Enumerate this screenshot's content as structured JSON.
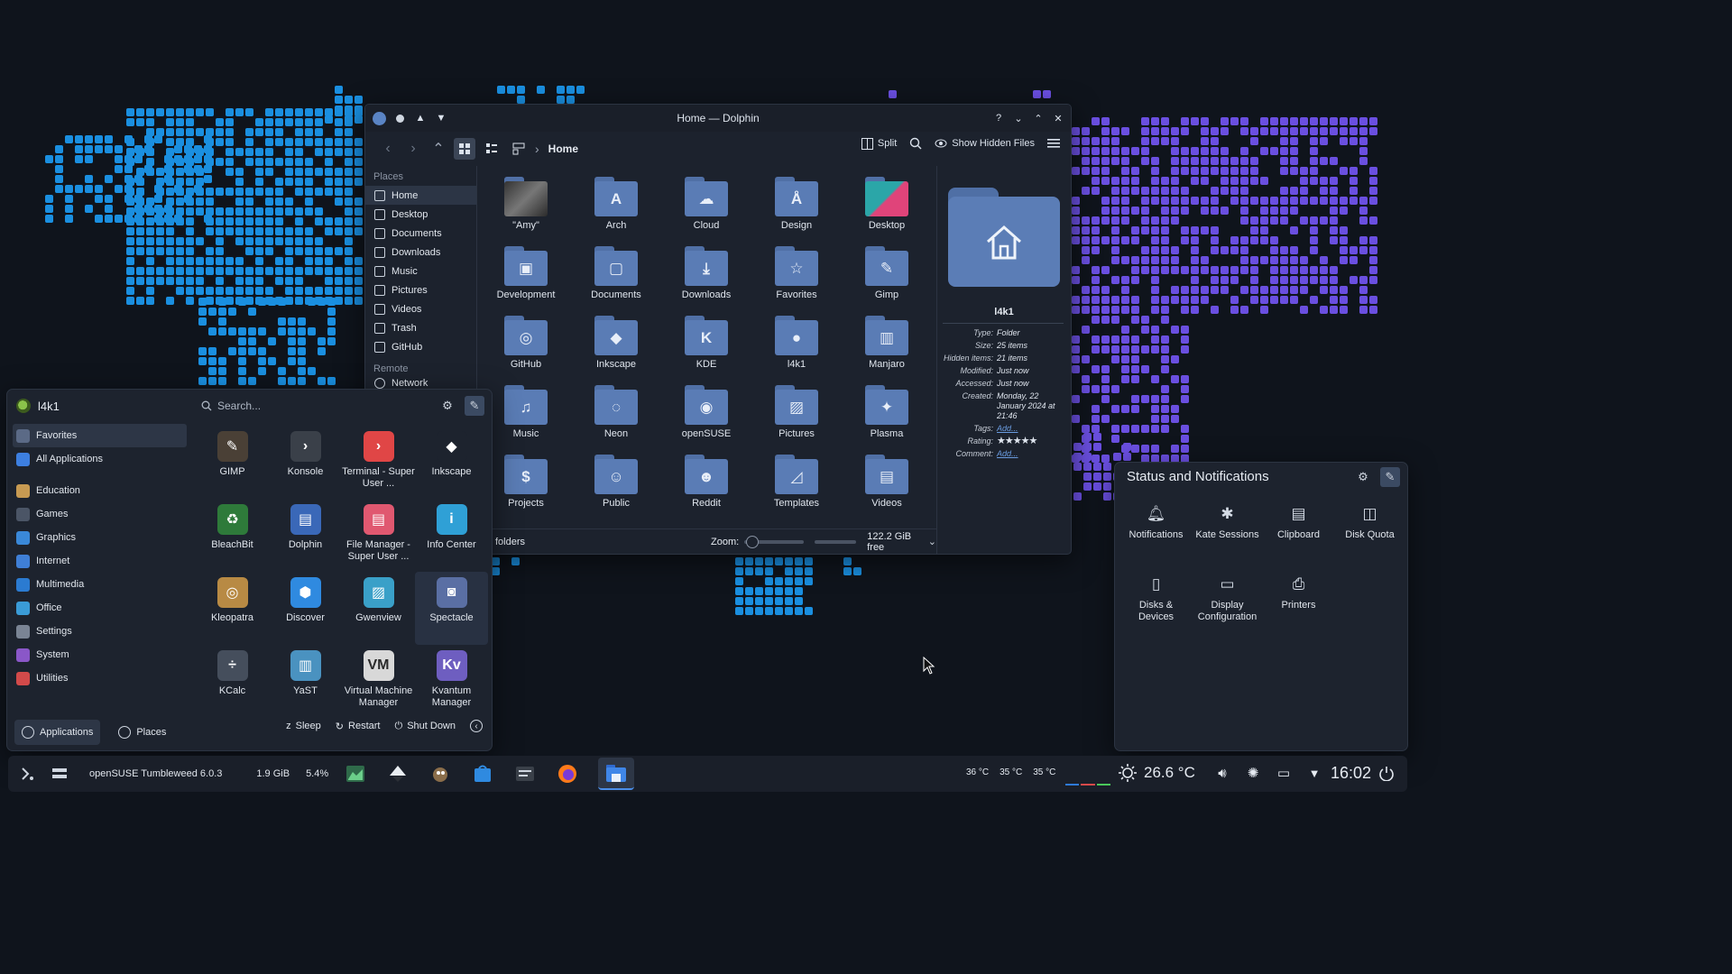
{
  "dolphin": {
    "title": "Home — Dolphin",
    "breadcrumb": "Home",
    "split_label": "Split",
    "hidden_files_label": "Show Hidden Files",
    "places_header": "Places",
    "remote_header": "Remote",
    "places": [
      {
        "label": "Home",
        "icon": "home-icon",
        "active": true
      },
      {
        "label": "Desktop",
        "icon": "desktop-icon"
      },
      {
        "label": "Documents",
        "icon": "documents-icon"
      },
      {
        "label": "Downloads",
        "icon": "downloads-icon"
      },
      {
        "label": "Music",
        "icon": "music-icon"
      },
      {
        "label": "Pictures",
        "icon": "pictures-icon"
      },
      {
        "label": "Videos",
        "icon": "videos-icon"
      },
      {
        "label": "Trash",
        "icon": "trash-icon"
      },
      {
        "label": "GitHub",
        "icon": "github-icon"
      }
    ],
    "remote_item": "Network",
    "files": [
      {
        "name": "\"Amy\"",
        "glyph": "",
        "style": "img"
      },
      {
        "name": "Arch",
        "glyph": "A"
      },
      {
        "name": "Cloud",
        "glyph": "☁"
      },
      {
        "name": "Design",
        "glyph": "Å"
      },
      {
        "name": "Desktop",
        "glyph": "",
        "style": "desk"
      },
      {
        "name": "Development",
        "glyph": "▣"
      },
      {
        "name": "Documents",
        "glyph": "▢"
      },
      {
        "name": "Downloads",
        "glyph": "⤓"
      },
      {
        "name": "Favorites",
        "glyph": "☆"
      },
      {
        "name": "Gimp",
        "glyph": "✎"
      },
      {
        "name": "GitHub",
        "glyph": "◎"
      },
      {
        "name": "Inkscape",
        "glyph": "◆"
      },
      {
        "name": "KDE",
        "glyph": "K"
      },
      {
        "name": "l4k1",
        "glyph": "●"
      },
      {
        "name": "Manjaro",
        "glyph": "▥"
      },
      {
        "name": "Music",
        "glyph": "♫"
      },
      {
        "name": "Neon",
        "glyph": "◌"
      },
      {
        "name": "openSUSE",
        "glyph": "◉"
      },
      {
        "name": "Pictures",
        "glyph": "▨"
      },
      {
        "name": "Plasma",
        "glyph": "✦"
      },
      {
        "name": "Projects",
        "glyph": "$"
      },
      {
        "name": "Public",
        "glyph": "☺"
      },
      {
        "name": "Reddit",
        "glyph": "☻"
      },
      {
        "name": "Templates",
        "glyph": "◿"
      },
      {
        "name": "Videos",
        "glyph": "▤"
      }
    ],
    "status_left": "folders",
    "zoom_label": "Zoom:",
    "free_space": "122.2 GiB free",
    "info": {
      "name": "l4k1",
      "rows": [
        {
          "key": "Type:",
          "value": "Folder"
        },
        {
          "key": "Size:",
          "value": "25 items"
        },
        {
          "key": "Hidden items:",
          "value": "21 items"
        },
        {
          "key": "Modified:",
          "value": "Just now"
        },
        {
          "key": "Accessed:",
          "value": "Just now"
        },
        {
          "key": "Created:",
          "value": "Monday, 22 January 2024 at 21:46"
        },
        {
          "key": "Tags:",
          "value": "Add...",
          "link": true
        },
        {
          "key": "Rating:",
          "value": "★★★★★",
          "stars": true
        },
        {
          "key": "Comment:",
          "value": "Add...",
          "link": true
        }
      ]
    }
  },
  "launcher": {
    "username": "l4k1",
    "search_placeholder": "Search...",
    "categories": [
      {
        "label": "Favorites",
        "color": "#5b6a86",
        "active": true
      },
      {
        "label": "All Applications",
        "color": "#3d7fe0"
      },
      {
        "sep": true
      },
      {
        "label": "Education",
        "color": "#c79a52"
      },
      {
        "label": "Games",
        "color": "#4b5566"
      },
      {
        "label": "Graphics",
        "color": "#3a88d8"
      },
      {
        "label": "Internet",
        "color": "#3f7fd6"
      },
      {
        "label": "Multimedia",
        "color": "#2b7bd1"
      },
      {
        "label": "Office",
        "color": "#3a9bd6"
      },
      {
        "label": "Settings",
        "color": "#7a8494"
      },
      {
        "label": "System",
        "color": "#8a57c8"
      },
      {
        "label": "Utilities",
        "color": "#d24a4a"
      }
    ],
    "apps": [
      {
        "name": "GIMP",
        "bg": "#4a4036",
        "glyph": "✎"
      },
      {
        "name": "Konsole",
        "bg": "#3a4049",
        "glyph": "›"
      },
      {
        "name": "Terminal - Super User ...",
        "bg": "#e04646",
        "glyph": "›"
      },
      {
        "name": "Inkscape",
        "bg": "#1d232e",
        "glyph": "◆"
      },
      {
        "name": "BleachBit",
        "bg": "#2e7a3a",
        "glyph": "♻"
      },
      {
        "name": "Dolphin",
        "bg": "#3a68b8",
        "glyph": "▤"
      },
      {
        "name": "File Manager - Super User ...",
        "bg": "#e05870",
        "glyph": "▤"
      },
      {
        "name": "Info Center",
        "bg": "#2fa0d6",
        "glyph": "i"
      },
      {
        "name": "Kleopatra",
        "bg": "#b88a44",
        "glyph": "◎"
      },
      {
        "name": "Discover",
        "bg": "#2f8ae0",
        "glyph": "⬢"
      },
      {
        "name": "Gwenview",
        "bg": "#3aa0c8",
        "glyph": "▨"
      },
      {
        "name": "Spectacle",
        "bg": "#5a6fa4",
        "glyph": "◙",
        "hover": true
      },
      {
        "name": "KCalc",
        "bg": "#454e5c",
        "glyph": "÷"
      },
      {
        "name": "YaST",
        "bg": "#4a92c0",
        "glyph": "▥"
      },
      {
        "name": "Virtual Machine Manager",
        "bg": "#d8d8d8",
        "glyph": "VM"
      },
      {
        "name": "Kvantum Manager",
        "bg": "#6e5ec0",
        "glyph": "Kv"
      }
    ],
    "footer_tabs": [
      "Applications",
      "Places"
    ],
    "power": [
      "Sleep",
      "Restart",
      "Shut Down"
    ]
  },
  "tray": {
    "title": "Status and Notifications",
    "items": [
      {
        "label": "Notifications",
        "icon": "bell-icon",
        "glyph": "🔔︎"
      },
      {
        "label": "Kate Sessions",
        "icon": "kate-icon",
        "glyph": "✱"
      },
      {
        "label": "Clipboard",
        "icon": "clipboard-icon",
        "glyph": "▤"
      },
      {
        "label": "Disk Quota",
        "icon": "disk-quota-icon",
        "glyph": "◫"
      },
      {
        "label": "Disks & Devices",
        "icon": "disks-icon",
        "glyph": "▯"
      },
      {
        "label": "Display Configuration",
        "icon": "display-icon",
        "glyph": "▭"
      },
      {
        "label": "Printers",
        "icon": "printer-icon",
        "glyph": "⎙"
      }
    ]
  },
  "taskbar": {
    "distro": "openSUSE Tumbleweed 6.0.3",
    "memory": "1.9 GiB",
    "cpu": "5.4%",
    "temps": [
      "36 °C",
      "35 °C",
      "35 °C"
    ],
    "weather_temp": "26.6 °C",
    "clock": "16:02"
  },
  "colors": {
    "accent": "#4b8ee8",
    "folder": "#5a7cb5",
    "wallpaper_blue": "#1a8fe0",
    "wallpaper_purple": "#6a4fe0"
  }
}
